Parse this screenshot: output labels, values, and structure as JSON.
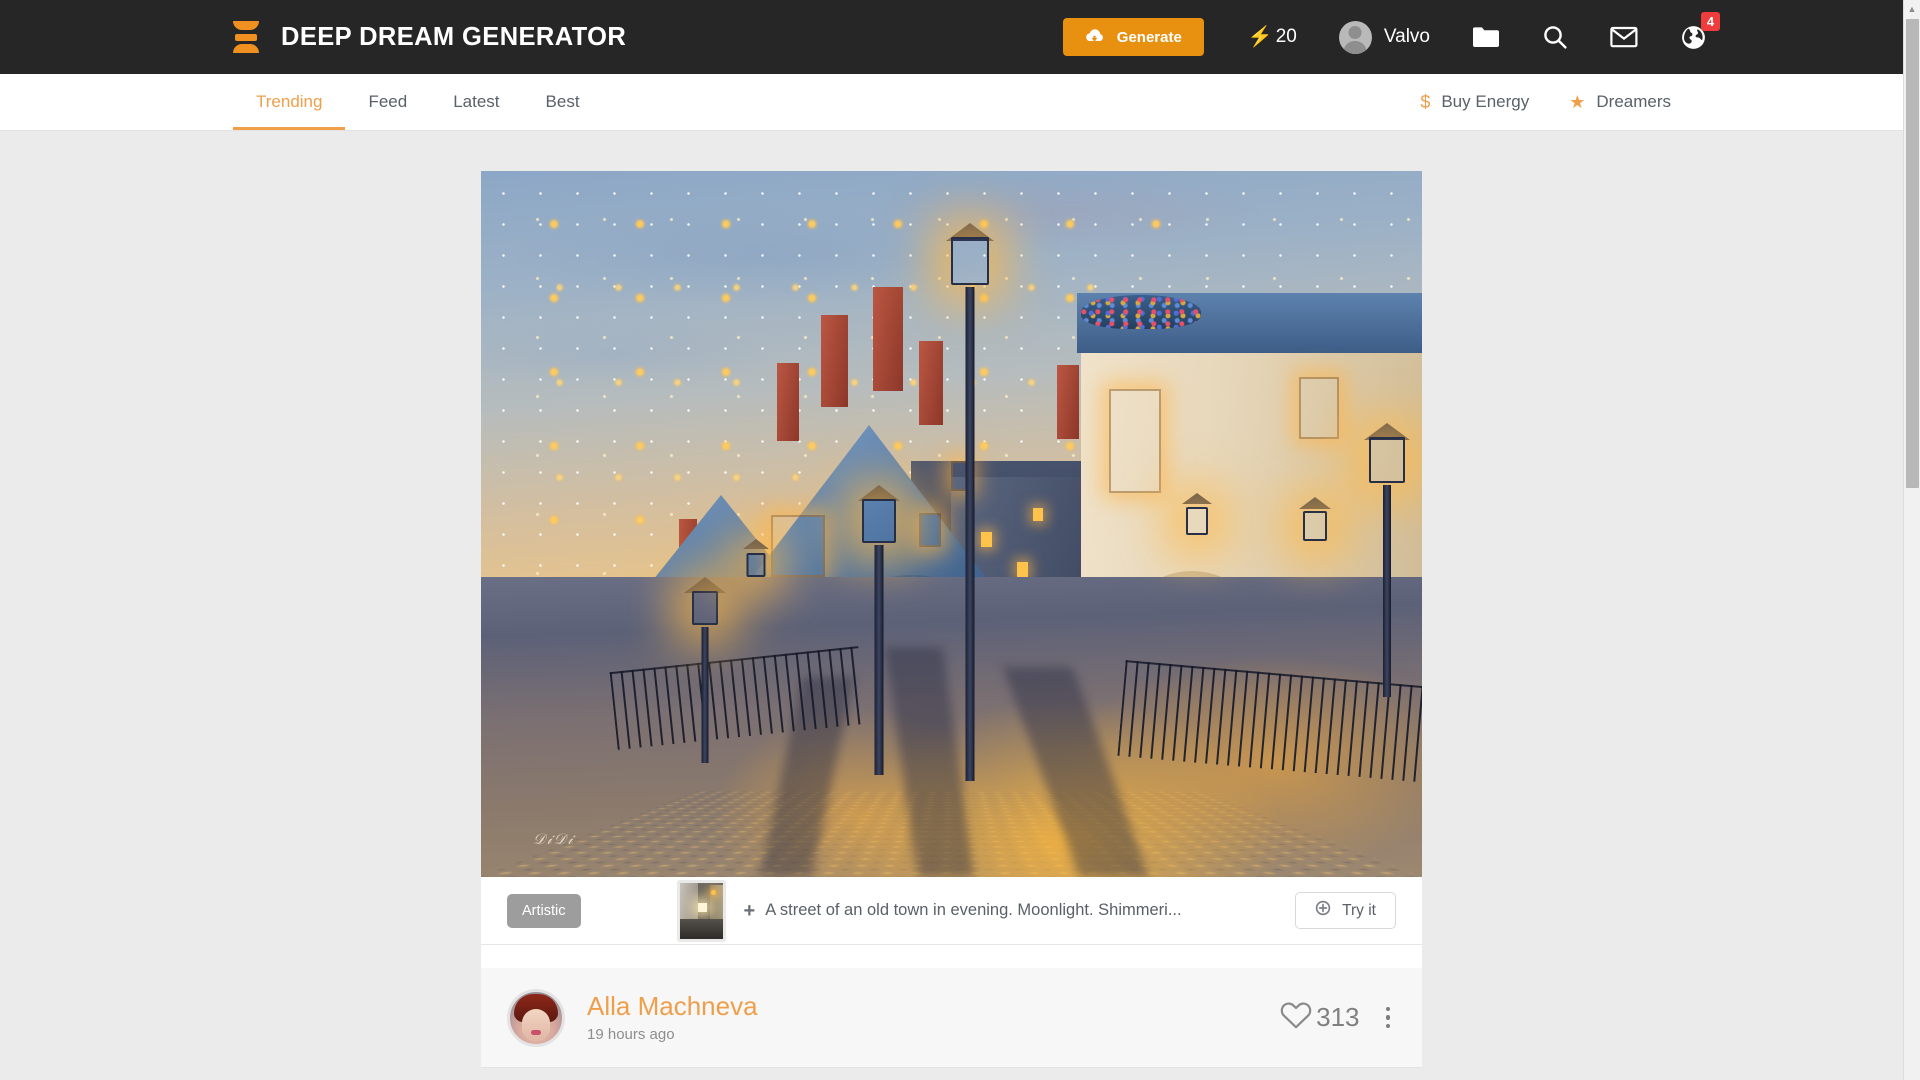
{
  "header": {
    "brand": "DEEP DREAM GENERATOR",
    "logo_icon": "hourglass-logo-icon",
    "generate_label": "Generate",
    "generate_icon": "cloud-upload-icon",
    "energy_icon": "lightning-bolt-icon",
    "energy_value": "20",
    "user_name": "Valvo",
    "user_avatar": "user-avatar-icon",
    "icons": {
      "folder": "folder-icon",
      "search": "search-icon",
      "mail": "mail-envelope-icon",
      "globe": "globe-notifications-icon"
    },
    "notification_badge": "4",
    "accent_color": "#e8900f",
    "bar_color": "#262626"
  },
  "nav": {
    "tabs": [
      {
        "label": "Trending",
        "active": true
      },
      {
        "label": "Feed",
        "active": false
      },
      {
        "label": "Latest",
        "active": false
      },
      {
        "label": "Best",
        "active": false
      }
    ],
    "links": [
      {
        "label": "Buy Energy",
        "icon": "dollar-sign-icon",
        "glyph": "$"
      },
      {
        "label": "Dreamers",
        "icon": "star-icon",
        "glyph": "★"
      }
    ],
    "active_color": "#ef9f4a",
    "text_color": "#596169"
  },
  "post": {
    "artwork_alt": "painted old-town street at evening with glowing street lamps, blue roofs and cobblestones",
    "tag": "Artistic",
    "thumbnail_alt": "reference photo of a night street",
    "prompt_plus": "+",
    "prompt_text": "A street of an old town in evening. Moonlight. Shimmeri...",
    "try_label": "Try it",
    "try_icon": "plus-circle-icon",
    "author_name": "Alla Machneva",
    "author_avatar_alt": "portrait of a woman with red hair",
    "timestamp": "19 hours ago",
    "like_icon": "heart-icon",
    "like_count": "313",
    "menu_icon": "kebab-menu-icon"
  },
  "scrollbar": {
    "up_arrow_icon": "scroll-up-arrow-icon",
    "thumb_icon": "scrollbar-thumb"
  }
}
